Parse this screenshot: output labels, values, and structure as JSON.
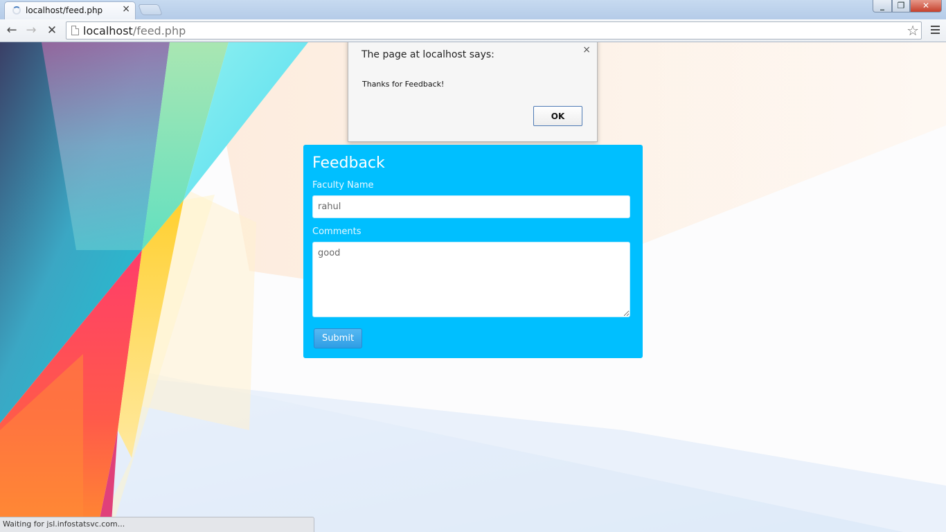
{
  "browser": {
    "tab_title": "localhost/feed.php",
    "tab_close": "×",
    "url_host": "localhost",
    "url_path": "/feed.php",
    "status_text": "Waiting for jsl.infostatsvc.com..."
  },
  "dialog": {
    "title": "The page at localhost says:",
    "message": "Thanks for Feedback!",
    "ok_label": "OK",
    "close_glyph": "×"
  },
  "form": {
    "title": "Feedback",
    "faculty_label": "Faculty Name",
    "faculty_value": "rahul",
    "comments_label": "Comments",
    "comments_value": "good",
    "submit_label": "Submit",
    "panel_color": "#00bfff"
  },
  "icons": {
    "back": "back-arrow-icon",
    "forward": "forward-arrow-icon",
    "stop": "stop-icon",
    "star": "star-icon",
    "menu": "menu-icon"
  }
}
